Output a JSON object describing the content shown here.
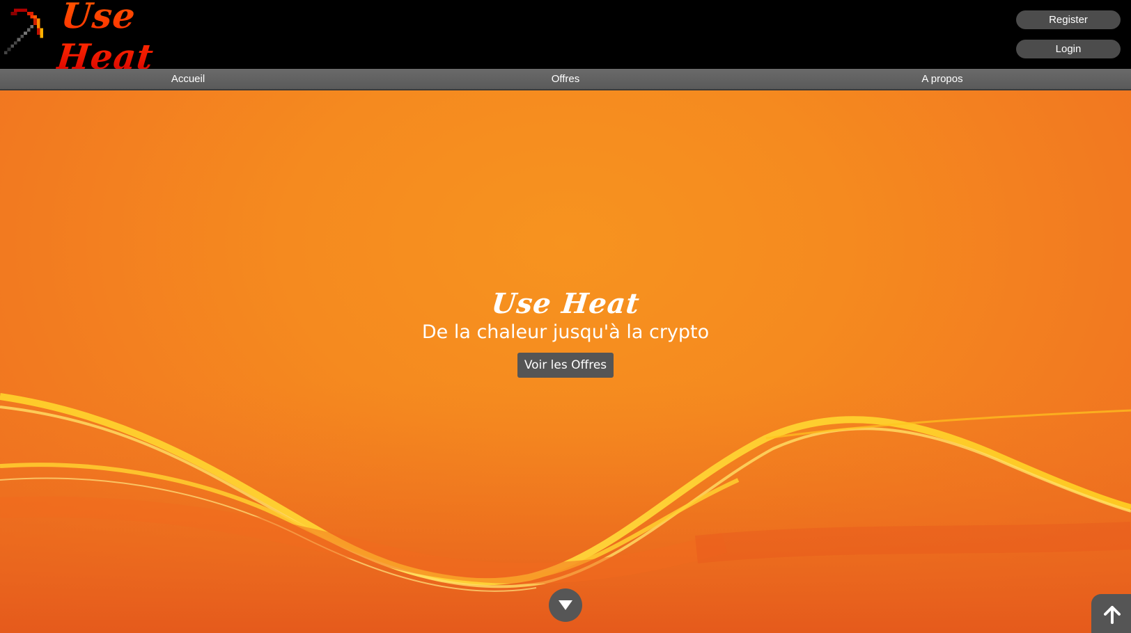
{
  "brand": {
    "logo_text": "Use Heat"
  },
  "auth": {
    "register_label": "Register",
    "login_label": "Login"
  },
  "nav": {
    "items": [
      {
        "label": "Accueil"
      },
      {
        "label": "Offres"
      },
      {
        "label": "A propos"
      }
    ]
  },
  "hero": {
    "title": "Use Heat",
    "subtitle": "De la chaleur jusqu'à la crypto",
    "cta_label": "Voir les Offres"
  },
  "icons": {
    "logo": "pickaxe-icon",
    "scroll_down": "chevron-down-icon",
    "scroll_top": "arrow-up-icon"
  },
  "colors": {
    "header_bg": "#000000",
    "nav_bg": "#5f5f5f",
    "hero_orange": "#f58a1f",
    "logo_red": "#ff2a00",
    "button_gray": "#555555"
  }
}
